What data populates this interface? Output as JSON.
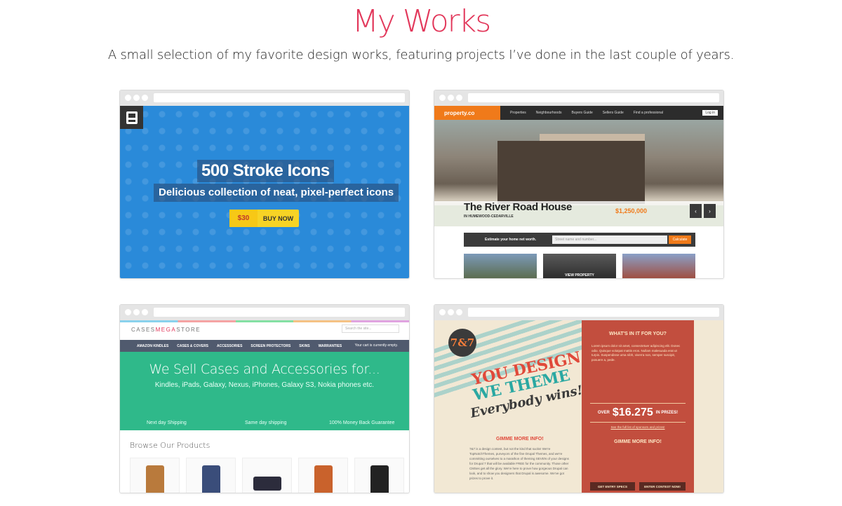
{
  "header": {
    "title": "My Works",
    "subtitle": "A small selection of my favorite design works, featuring projects I’ve done in the last couple of years."
  },
  "works": {
    "icons": {
      "title": "500 Stroke Icons",
      "subtitle": "Delicious collection of neat, pixel-perfect icons",
      "price": "$30",
      "buy": "BUY NOW"
    },
    "property": {
      "logo": "property.co",
      "nav": [
        "Properties",
        "Neighbourhoods",
        "Buyers Guide",
        "Sellers Guide",
        "Find a professional"
      ],
      "login": "Log in",
      "house_name": "The River Road House",
      "location": "IN HUMEWOOD-CEDARVILLE",
      "price": "$1,250,000",
      "estimate_label": "Estimate your home net worth.",
      "search_placeholder": "Street name and number...",
      "calculate": "Calculate",
      "view_property": "VIEW PROPERTY"
    },
    "cases": {
      "logo_prefix": "CASES",
      "logo_mid": "MEGA",
      "logo_suffix": "STORE",
      "search_placeholder": "Search the site...",
      "nav": [
        "AMAZON KINDLES",
        "CASES & COVERS",
        "ACCESSORIES",
        "SCREEN PROTECTORS",
        "SKINS",
        "WARRANTIES"
      ],
      "cart": "Your cart is currently empty.",
      "hero_title": "We Sell Cases and Accessories for...",
      "hero_sub": "Kindles, iPads, Galaxy, Nexus, iPhones, Galaxy S3, Nokia phones etc.",
      "features": [
        "Next day Shipping",
        "Same day shipping",
        "100% Money Back Guarantee"
      ],
      "browse": "Browse Our Products"
    },
    "contest": {
      "badge": "7&7",
      "line1": "YOU DESIGN",
      "line2": "WE THEME",
      "line3": "Everybody wins!",
      "gimme_left": "GIMME MORE INFO!",
      "para": "7&7 is a design contest, but not the kind that sucks! We're TopNotchThemes, purveyors of the fine Drupal Themes, and we're committing ourselves to a marathon of theming SEVEN of your designs for Drupal 7 that will be available FREE for the community. Those other CMSes get all the glory. We're here to prove how gorgeous Drupal can look, and to show you designers that Drupal is awesome. We've got prizes to prove it.",
      "whats_in": "WHAT'S IN IT FOR YOU?",
      "whats_text": "Lorem ipsum dolor sit amet, consectetuer adipiscing elit. Donec odio. Quisque volutpat mattis eros. Nullam malesuada erat ut turpis. Suspendisse urna nibh, viverra non, semper suscipit, posuere a, pede.",
      "prize_over": "OVER",
      "prize_amount": "$16.275",
      "prize_in": "IN PRIZES!",
      "sponsor_link": "See the full list of sponsors and prizes!",
      "gimme_right": "GIMME MORE INFO!",
      "btn_left": "GET ENTRY SPECS",
      "btn_right": "ENTER CONTEST NOW!"
    }
  }
}
